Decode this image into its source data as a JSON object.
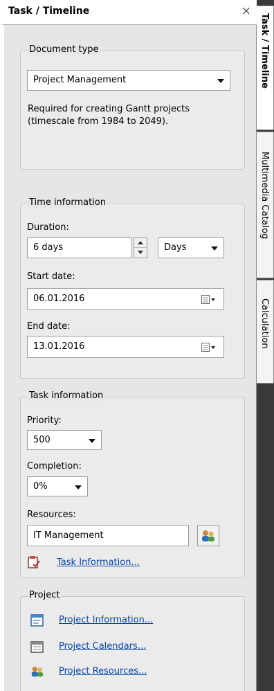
{
  "panel": {
    "title": "Task / Timeline",
    "close_glyph": "×"
  },
  "document_type": {
    "legend": "Document type",
    "selected": "Project Management",
    "description_line1": "Required for creating Gantt projects",
    "description_line2": "(timescale from 1984 to 2049)."
  },
  "time_information": {
    "legend": "Time information",
    "duration_label": "Duration:",
    "duration_value": "6 days",
    "duration_unit": "Days",
    "start_label": "Start date:",
    "start_value": "06.01.2016",
    "end_label": "End date:",
    "end_value": "13.01.2016"
  },
  "task_information": {
    "legend": "Task information",
    "priority_label": "Priority:",
    "priority_value": "500",
    "completion_label": "Completion:",
    "completion_value": "0%",
    "resources_label": "Resources:",
    "resources_value": "IT Management",
    "task_info_link": "Task Information..."
  },
  "project": {
    "legend": "Project",
    "links": [
      "Project Information...",
      "Project Calendars...",
      "Project Resources..."
    ]
  },
  "side_tabs": [
    "Task / Timeline",
    "Multimedia Catalog",
    "Calculation"
  ],
  "colors": {
    "link": "#0645ad",
    "panel_bg": "#e6e6e6",
    "tabstrip_bg": "#3a3a3a"
  }
}
